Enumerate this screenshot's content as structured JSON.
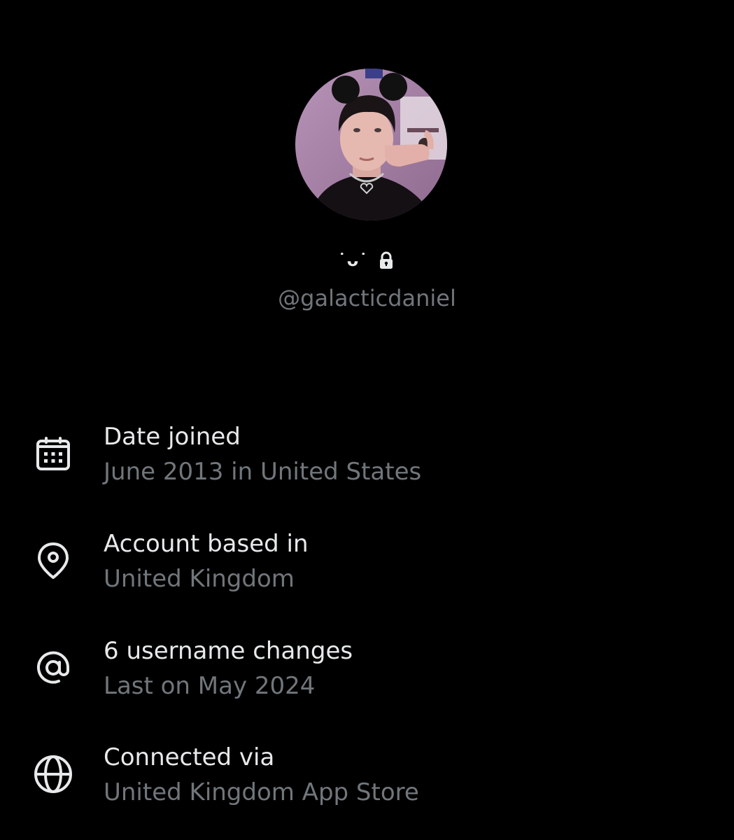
{
  "profile": {
    "display_name": "˙ᴗ˙",
    "handle": "@galacticdaniel",
    "avatar_icon": "profile-photo",
    "lock_icon": "lock-icon"
  },
  "colors": {
    "background": "#000000",
    "primary_text": "#e7e9ea",
    "secondary_text": "#71767b"
  },
  "info": [
    {
      "icon": "calendar-icon",
      "title": "Date joined",
      "value": "June 2013 in United States"
    },
    {
      "icon": "location-pin-icon",
      "title": "Account based in",
      "value": "United Kingdom"
    },
    {
      "icon": "at-sign-icon",
      "title": "6 username changes",
      "value": "Last on May 2024"
    },
    {
      "icon": "globe-icon",
      "title": "Connected via",
      "value": "United Kingdom App Store"
    }
  ]
}
